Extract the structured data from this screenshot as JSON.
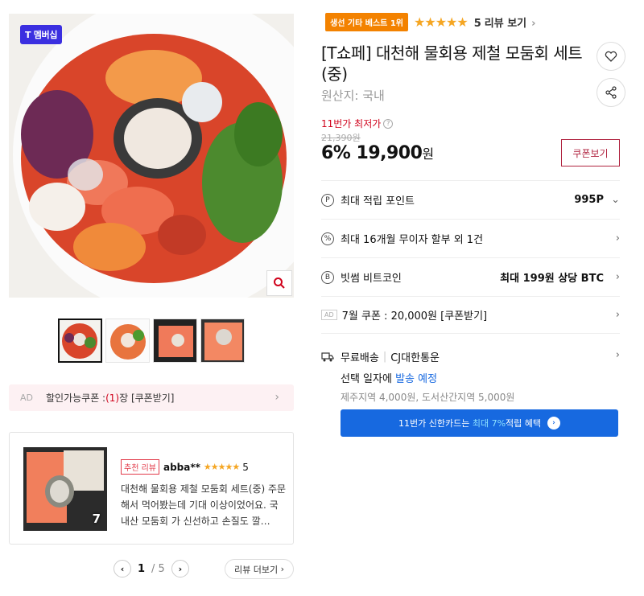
{
  "main_image": {
    "badge": "T 멤버십"
  },
  "thumbnails": [
    "thumb-1",
    "thumb-2",
    "thumb-3",
    "thumb-4"
  ],
  "coupon_bar": {
    "ad": "AD",
    "label": "할인가능쿠폰 : ",
    "count": "(1)",
    "suffix": "장 [쿠폰받기]"
  },
  "review": {
    "badge": "추천 리뷰",
    "user": "abba**",
    "stars": "★★★★★",
    "score": "5",
    "image_count": "7",
    "text": "대천해 물회용 제철 모둠회 세트(중) 주문해서 먹어봤는데 기대 이상이었어요. 국내산 모둠회 가 신선하고 손질도 깔…"
  },
  "pager": {
    "current": "1",
    "total": "/ 5",
    "more": "리뷰 더보기"
  },
  "bestseller": {
    "badge": "생선 기타 베스트 1위",
    "stars": "★★★★★",
    "count": "5",
    "label": "리뷰 보기"
  },
  "product": {
    "title": "[T쇼페] 대천해 물회용 제철 모둠회 세트(중)",
    "origin": "원산지: 국내",
    "lowest_label": "11번가 최저가",
    "original_price": "21,390원",
    "price": "6% 19,900",
    "won": "원",
    "coupon_button": "쿠폰보기"
  },
  "info_rows": {
    "points": {
      "label": "최대 적립 포인트",
      "value": "995P"
    },
    "installment": {
      "label": "최대 16개월 무이자 할부 외 1건"
    },
    "bitcoin": {
      "label": "빗썸 비트코인",
      "value": "최대 199원 상당 BTC"
    },
    "coupon": {
      "ad": "AD",
      "label": "7월 쿠폰 : 20,000원 [쿠폰받기]"
    }
  },
  "shipping": {
    "type": "무료배송",
    "carrier": "CJ대한통운",
    "date_prefix": "선택 일자에 ",
    "date_highlight": "발송 예정",
    "extra": "제주지역 4,000원, 도서산간지역 5,000원"
  },
  "card_banner": {
    "prefix": "11번가 신한카드는 ",
    "highlight": "최대 7%",
    "suffix": " 적립 혜택"
  },
  "colors": {
    "accent": "#d0021b",
    "blue": "#1769e0",
    "badge_orange": "#f38200",
    "membership": "#3b2fe0"
  }
}
